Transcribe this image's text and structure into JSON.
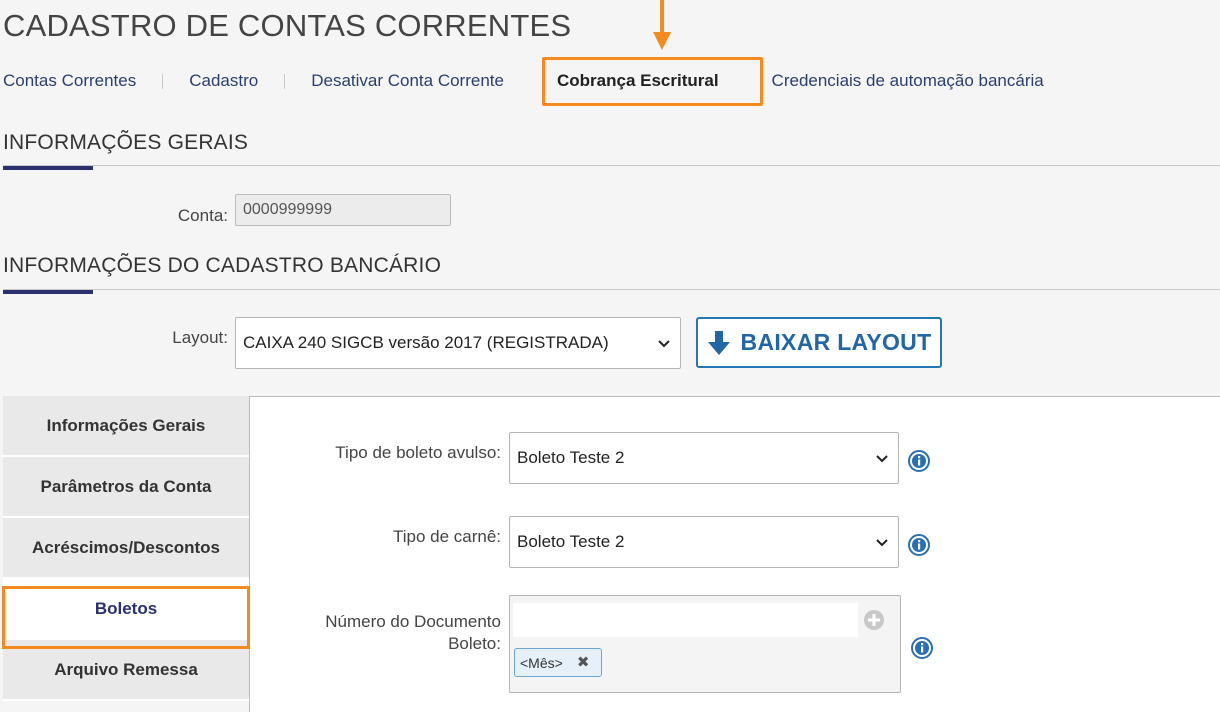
{
  "page": {
    "title": "CADASTRO DE CONTAS CORRENTES"
  },
  "tabs": [
    {
      "label": "Contas Correntes"
    },
    {
      "label": "Cadastro"
    },
    {
      "label": "Desativar Conta Corrente"
    },
    {
      "label": "Cobrança Escritural",
      "active": true
    },
    {
      "label": "Credenciais de automação bancária"
    }
  ],
  "general": {
    "title": "INFORMAÇÕES GERAIS",
    "account_label": "Conta:",
    "account_value": "0000999999"
  },
  "bank": {
    "title": "INFORMAÇÕES DO CADASTRO BANCÁRIO",
    "layout_label": "Layout:",
    "layout_value": "CAIXA 240 SIGCB versão 2017 (REGISTRADA)",
    "download_label": "BAIXAR LAYOUT"
  },
  "sidenav": [
    {
      "label": "Informações Gerais"
    },
    {
      "label": "Parâmetros da Conta"
    },
    {
      "label": "Acréscimos/Descontos"
    },
    {
      "label": "Boletos",
      "active": true
    },
    {
      "label": "Arquivo Remessa"
    }
  ],
  "boletos": {
    "avulso_label": "Tipo de boleto avulso:",
    "avulso_value": "Boleto Teste 2",
    "carne_label": "Tipo de carnê:",
    "carne_value": "Boleto Teste 2",
    "doc_label_line1": "Número do Documento",
    "doc_label_line2": "Boleto:",
    "doc_chip": "<Mês>"
  },
  "colors": {
    "highlight": "#f58a1f",
    "accent": "#2a3070",
    "link": "#2a3f6e",
    "button": "#2166a6"
  }
}
